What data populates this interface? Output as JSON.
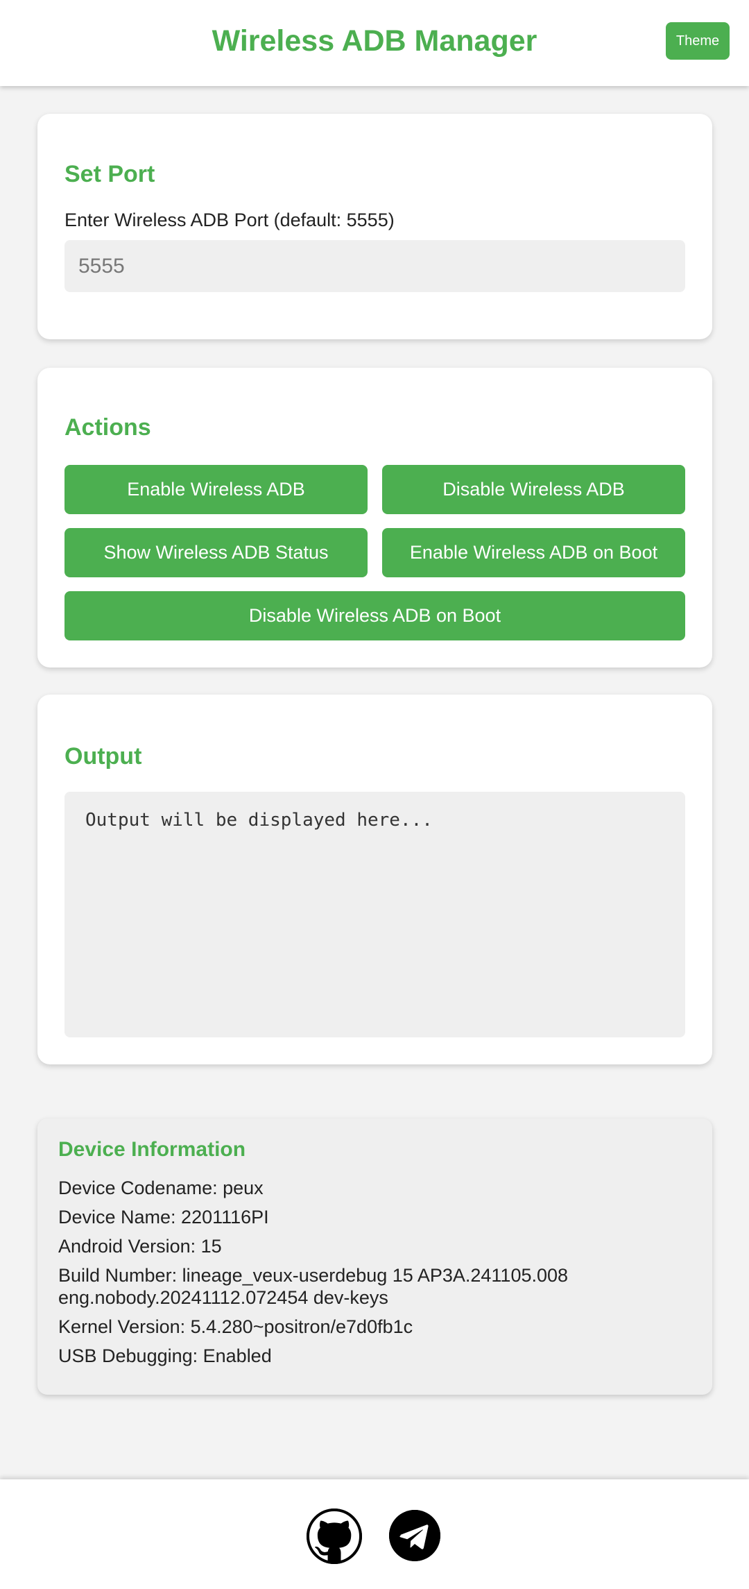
{
  "header": {
    "title": "Wireless ADB Manager",
    "theme_label": "Theme"
  },
  "port_section": {
    "title": "Set Port",
    "label": "Enter Wireless ADB Port (default: 5555)",
    "value": "",
    "placeholder": "5555"
  },
  "actions_section": {
    "title": "Actions",
    "buttons": [
      {
        "label": "Enable Wireless ADB"
      },
      {
        "label": "Disable Wireless ADB"
      },
      {
        "label": "Show Wireless ADB Status"
      },
      {
        "label": "Enable Wireless ADB on Boot"
      },
      {
        "label": "Disable Wireless ADB on Boot"
      }
    ]
  },
  "output_section": {
    "title": "Output",
    "text": "Output will be displayed here..."
  },
  "device_info": {
    "title": "Device Information",
    "lines": [
      "Device Codename: peux",
      "Device Name: 2201116PI",
      "Android Version: 15",
      "Build Number: lineage_veux-userdebug 15 AP3A.241105.008 eng.nobody.20241112.072454 dev-keys",
      "Kernel Version: 5.4.280~positron/e7d0fb1c",
      "USB Debugging: Enabled"
    ]
  },
  "footer": {
    "links": [
      {
        "icon": "github-icon"
      },
      {
        "icon": "telegram-icon"
      }
    ]
  },
  "colors": {
    "accent": "#4caf50",
    "background": "#f3f3f3",
    "card": "#ffffff",
    "field": "#efefef"
  }
}
